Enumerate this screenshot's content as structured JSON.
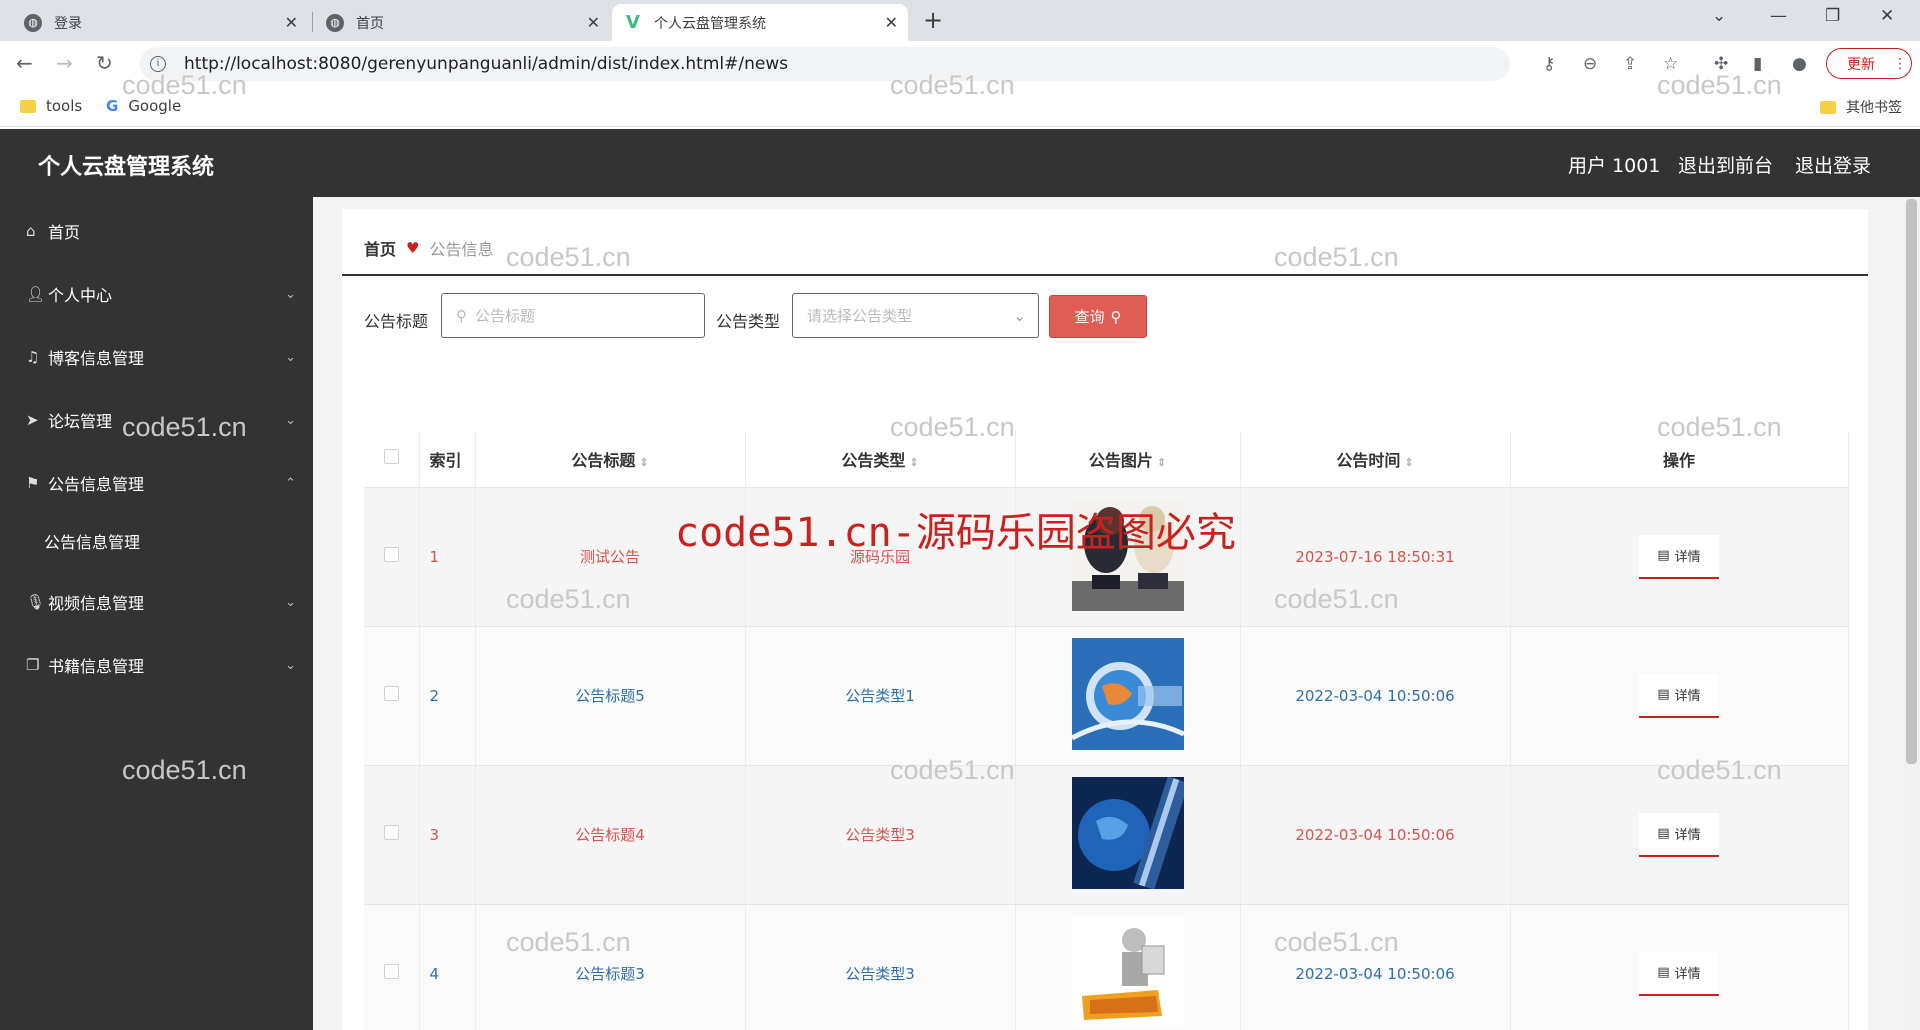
{
  "browser": {
    "tabs": [
      {
        "title": "登录"
      },
      {
        "title": "首页"
      },
      {
        "title": "个人云盘管理系统"
      }
    ],
    "url": "http://localhost:8080/gerenyunpanguanli/admin/dist/index.html#/news",
    "update_label": "更新",
    "bookmarks": [
      {
        "label": "tools"
      },
      {
        "label": "Google"
      }
    ],
    "other_bookmarks": "其他书签"
  },
  "header": {
    "title": "个人云盘管理系统",
    "user": "用户 1001",
    "exit_front": "退出到前台",
    "logout": "退出登录"
  },
  "sidebar": {
    "items": [
      {
        "label": "首页",
        "icon": "home-icon"
      },
      {
        "label": "个人中心",
        "icon": "user-icon"
      },
      {
        "label": "博客信息管理",
        "icon": "bell-icon"
      },
      {
        "label": "论坛管理",
        "icon": "send-icon"
      },
      {
        "label": "公告信息管理",
        "icon": "flag-icon"
      },
      {
        "label": "公告信息管理",
        "icon": ""
      },
      {
        "label": "视频信息管理",
        "icon": "mic-icon"
      },
      {
        "label": "书籍信息管理",
        "icon": "copy-icon"
      }
    ]
  },
  "breadcrumb": {
    "home": "首页",
    "current": "公告信息"
  },
  "search": {
    "title_label": "公告标题",
    "title_placeholder": "公告标题",
    "type_label": "公告类型",
    "type_placeholder": "请选择公告类型",
    "query_button": "查询"
  },
  "table": {
    "headers": [
      "索引",
      "公告标题",
      "公告类型",
      "公告图片",
      "公告时间",
      "操作"
    ],
    "detail_label": "详情",
    "rows": [
      {
        "index": "1",
        "title": "测试公告",
        "type": "源码乐园",
        "time": "2023-07-16 18:50:31"
      },
      {
        "index": "2",
        "title": "公告标题5",
        "type": "公告类型1",
        "time": "2022-03-04 10:50:06"
      },
      {
        "index": "3",
        "title": "公告标题4",
        "type": "公告类型3",
        "time": "2022-03-04 10:50:06"
      },
      {
        "index": "4",
        "title": "公告标题3",
        "type": "公告类型3",
        "time": "2022-03-04 10:50:06"
      }
    ]
  },
  "watermarks": {
    "small": "code51.cn",
    "big": "code51.cn-源码乐园盗图必究"
  },
  "colors": {
    "header_bg": "#333333",
    "accent_red": "#d9534f",
    "link_blue": "#2f6fa7",
    "query_button": "#e05d55"
  }
}
